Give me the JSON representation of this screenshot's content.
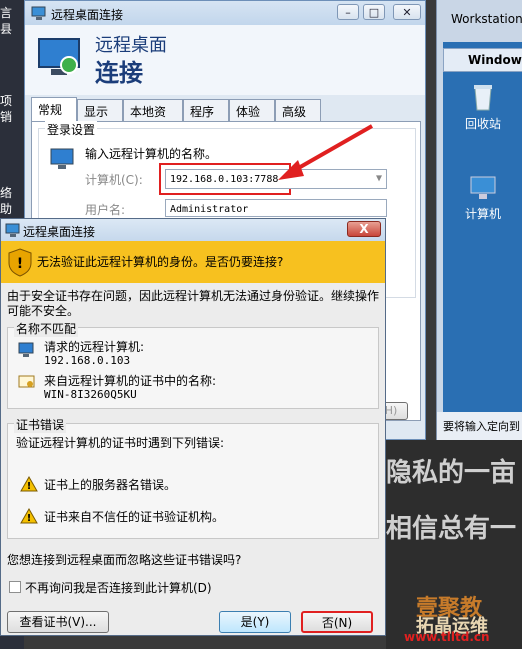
{
  "desktop_left": {
    "fragments": [
      "言",
      "县",
      "项",
      "销",
      "络",
      "助"
    ]
  },
  "bg_window": {
    "title": "Workstation",
    "inner_title": "Windows",
    "icons": [
      {
        "label": "回收站",
        "icon": "recycle-bin-icon"
      },
      {
        "label": "计算机",
        "icon": "computer-icon"
      }
    ],
    "status": "要将输入定向到"
  },
  "promo": {
    "line1": "隐私的一亩",
    "line2": "相信总有一",
    "watermark": "壹聚教",
    "watermark_site": "拓晶运维",
    "url": "www.tlltd.cn"
  },
  "rdc": {
    "title": "远程桌面连接",
    "header_line1": "远程桌面",
    "header_line2": "连接",
    "tabs": [
      "常规",
      "显示",
      "本地资源",
      "程序",
      "体验",
      "高级"
    ],
    "group_title": "登录设置",
    "prompt": "输入远程计算机的名称。",
    "computer_label": "计算机(C):",
    "computer_value": "192.168.0.103:7788",
    "user_label": "用户名:",
    "user_value": "Administrator",
    "fragment_right_btn": "H)"
  },
  "warn": {
    "title": "远程桌面连接",
    "close": "X",
    "banner": "无法验证此远程计算机的身份。是否仍要连接?",
    "desc": "由于安全证书存在问题，因此远程计算机无法通过身份验证。继续操作可能不安全。",
    "mismatch_title": "名称不匹配",
    "requested_label": "请求的远程计算机:",
    "requested_value": "192.168.0.103",
    "cert_label": "来自远程计算机的证书中的名称:",
    "cert_value": "WIN-8I3260Q5KU",
    "errors_title": "证书错误",
    "errors_desc": "验证远程计算机的证书时遇到下列错误:",
    "error1": "证书上的服务器名错误。",
    "error2": "证书来自不信任的证书验证机构。",
    "question": "您想连接到远程桌面而忽略这些证书错误吗?",
    "dont_ask": "不再询问我是否连接到此计算机(D)",
    "view_cert": "查看证书(V)...",
    "yes": "是(Y)",
    "no": "否(N)"
  },
  "colors": {
    "banner": "#f7c11f",
    "annotation_red": "#e02020",
    "title_blue": "#1b3d7a"
  }
}
